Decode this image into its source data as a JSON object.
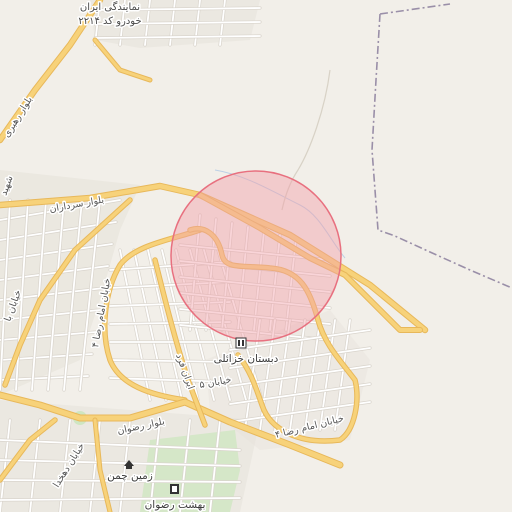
{
  "map": {
    "colors": {
      "land": "#f2efe9",
      "primary_road": "#f7d27a",
      "primary_casing": "#e8b85a",
      "minor_road": "#ffffff",
      "minor_casing": "#d9d4cc",
      "boundary": "#9a8fa8",
      "green": "#cfe6c2",
      "urban_block": "#e6e2db",
      "circle_fill": "#f2a0a8",
      "circle_stroke": "#e8707f"
    },
    "labels": {
      "dealer_line1": "نمایندگی ایران",
      "dealer_line2": "خودرو کد ۲۲۱۴",
      "blvd_rahbari": "بلوار رهبری",
      "blvd_sardaran": "بلوار سرداران",
      "blvd_sardaran_short": "شهید",
      "blvd_rezvan": "بلوار رضوان",
      "st_imam_reza_4_left": "خیابان امام رضا ۴",
      "st_imam_reza_4_right": "خیابان امام رضا ۴",
      "st_iran_fard": "ایران فرد",
      "st_khayyam": "خیابان ۵",
      "st_dehkhoda": "خیابان دهخدا",
      "school": "دبستان خزائلی",
      "zamin_chaman": "زمین چمن",
      "behesht_rezvan": "بهشت رضوان",
      "st_bal": "خیابان با"
    },
    "icons": {
      "school": "school-icon",
      "zamin_chaman": "sports-field-icon",
      "behesht_rezvan": "cemetery-icon"
    },
    "highlight": {
      "type": "radius-circle"
    }
  }
}
